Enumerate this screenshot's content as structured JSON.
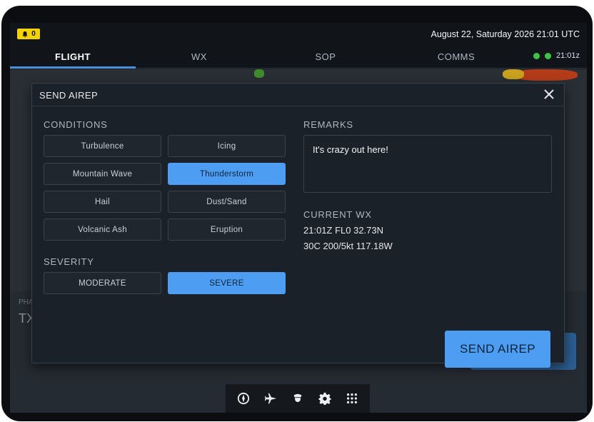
{
  "status": {
    "alert_count": "0",
    "datetime": "August 22, Saturday 2026 21:01 UTC",
    "clock": "21:01z"
  },
  "tabs": [
    {
      "label": "FLIGHT",
      "active": true
    },
    {
      "label": "WX",
      "active": false
    },
    {
      "label": "SOP",
      "active": false
    },
    {
      "label": "COMMS",
      "active": false
    }
  ],
  "background": {
    "phase_label": "PHA",
    "phase_value": "TX"
  },
  "modal": {
    "title": "SEND AIREP",
    "conditions_label": "CONDITIONS",
    "conditions": [
      {
        "label": "Turbulence",
        "selected": false
      },
      {
        "label": "Icing",
        "selected": false
      },
      {
        "label": "Mountain Wave",
        "selected": false
      },
      {
        "label": "Thunderstorm",
        "selected": true
      },
      {
        "label": "Hail",
        "selected": false
      },
      {
        "label": "Dust/Sand",
        "selected": false
      },
      {
        "label": "Volcanic Ash",
        "selected": false
      },
      {
        "label": "Eruption",
        "selected": false
      }
    ],
    "severity_label": "SEVERITY",
    "severity": [
      {
        "label": "MODERATE",
        "selected": false
      },
      {
        "label": "SEVERE",
        "selected": true
      }
    ],
    "remarks_label": "REMARKS",
    "remarks_value": "It's crazy out here!",
    "current_wx_label": "CURRENT WX",
    "current_wx_line1": "21:01Z FL0 32.73N",
    "current_wx_line2": "30C 200/5kt 117.18W",
    "send_label": "SEND AIREP"
  },
  "bottom_nav": [
    "compass-icon",
    "airplane-icon",
    "pilot-icon",
    "gear-icon",
    "apps-grid-icon"
  ],
  "colors": {
    "accent": "#4d9df2",
    "alert": "#f2d300",
    "connected": "#3ec34a",
    "background": "#1b2129"
  }
}
